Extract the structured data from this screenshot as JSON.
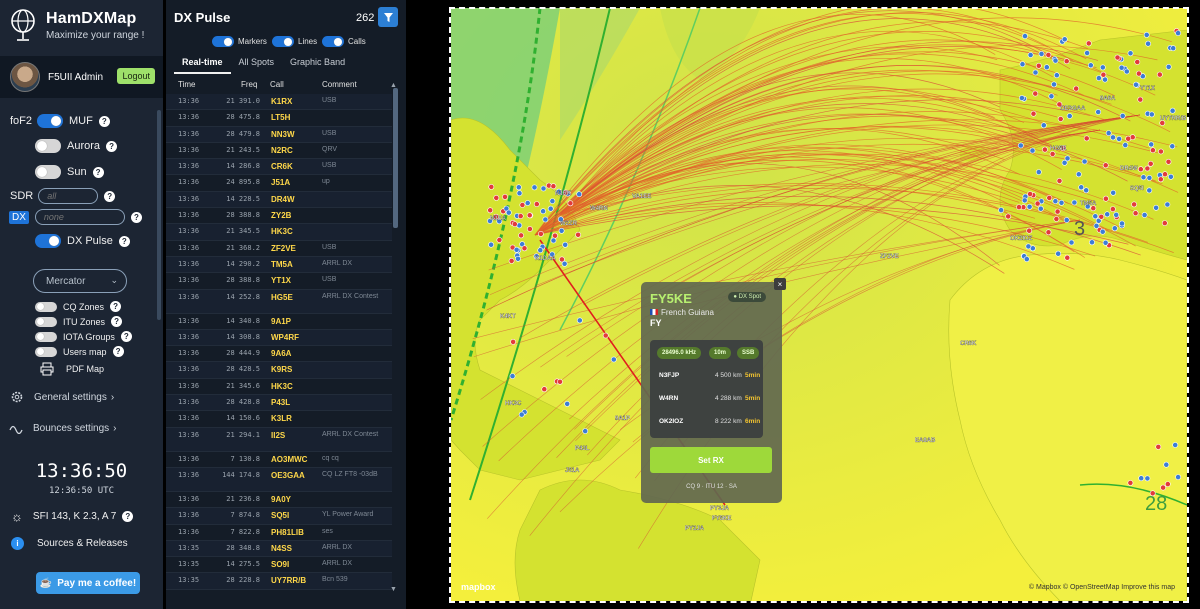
{
  "brand": {
    "title": "HamDXMap",
    "subtitle": "Maximize your range !"
  },
  "user": {
    "name": "F5UII Admin",
    "logout": "Logout"
  },
  "layers": {
    "fof2": "foF2",
    "muf": "MUF",
    "aurora": "Aurora",
    "sun": "Sun",
    "sdr_label": "SDR",
    "sdr_placeholder": "all",
    "dx_label": "DX",
    "dx_placeholder": "none",
    "dx_pulse": "DX Pulse",
    "projection": "Mercator",
    "cq_zones": "CQ Zones",
    "itu_zones": "ITU Zones",
    "iota": "IOTA Groups",
    "users_map": "Users map",
    "pdf_map": "PDF Map",
    "general_settings": "General settings",
    "bounces_settings": "Bounces settings"
  },
  "clock": {
    "local": "13:36:50",
    "utc": "12:36:50 UTC"
  },
  "solar": "SFI 143, K 2.3, A 7",
  "sources": "Sources & Releases",
  "coffee": "Pay me a coffee!",
  "pulse": {
    "title": "DX Pulse",
    "count": "262",
    "toggles": {
      "markers": "Markers",
      "lines": "Lines",
      "calls": "Calls"
    },
    "tabs": [
      "Real-time",
      "All Spots",
      "Graphic Band"
    ],
    "columns": {
      "time": "Time",
      "freq": "Freq",
      "call": "Call",
      "comment": "Comment"
    },
    "rows": [
      {
        "time": "13:36",
        "freq": "21 391.0",
        "call": "K1RX",
        "comment": "USB"
      },
      {
        "time": "13:36",
        "freq": "28 475.8",
        "call": "LT5H",
        "comment": ""
      },
      {
        "time": "13:36",
        "freq": "28 479.8",
        "call": "NN3W",
        "comment": "USB"
      },
      {
        "time": "13:36",
        "freq": "21 243.5",
        "call": "N2RC",
        "comment": "QRV"
      },
      {
        "time": "13:36",
        "freq": "14 286.8",
        "call": "CR6K",
        "comment": "USB"
      },
      {
        "time": "13:36",
        "freq": "24 895.8",
        "call": "J51A",
        "comment": "up"
      },
      {
        "time": "13:36",
        "freq": "14 228.5",
        "call": "DR4W",
        "comment": ""
      },
      {
        "time": "13:36",
        "freq": "28 388.8",
        "call": "ZY2B",
        "comment": ""
      },
      {
        "time": "13:36",
        "freq": "21 345.5",
        "call": "HK3C",
        "comment": ""
      },
      {
        "time": "13:36",
        "freq": "21 368.2",
        "call": "ZF2VE",
        "comment": "USB"
      },
      {
        "time": "13:36",
        "freq": "14 290.2",
        "call": "TM5A",
        "comment": "ARRL DX"
      },
      {
        "time": "13:36",
        "freq": "28 388.8",
        "call": "YT1X",
        "comment": "USB"
      },
      {
        "time": "13:36",
        "freq": "14 252.8",
        "call": "HG5E",
        "comment": "ARRL DX Contest"
      },
      {
        "time": "13:36",
        "freq": "14 340.8",
        "call": "9A1P",
        "comment": ""
      },
      {
        "time": "13:36",
        "freq": "14 308.8",
        "call": "WP4RF",
        "comment": ""
      },
      {
        "time": "13:36",
        "freq": "28 444.9",
        "call": "9A6A",
        "comment": ""
      },
      {
        "time": "13:36",
        "freq": "28 428.5",
        "call": "K9RS",
        "comment": ""
      },
      {
        "time": "13:36",
        "freq": "21 345.6",
        "call": "HK3C",
        "comment": ""
      },
      {
        "time": "13:36",
        "freq": "28 428.8",
        "call": "P43L",
        "comment": ""
      },
      {
        "time": "13:36",
        "freq": "14 150.6",
        "call": "K3LR",
        "comment": ""
      },
      {
        "time": "13:36",
        "freq": "21 294.1",
        "call": "II2S",
        "comment": "ARRL DX Contest"
      },
      {
        "time": "13:36",
        "freq": "7 130.8",
        "call": "AO3MWC",
        "comment": "cq cq"
      },
      {
        "time": "13:36",
        "freq": "144 174.8",
        "call": "OE3GAA",
        "comment": "CQ LZ FT8 -03dB"
      },
      {
        "time": "13:36",
        "freq": "21 236.8",
        "call": "9A0Y",
        "comment": ""
      },
      {
        "time": "13:36",
        "freq": "7 874.8",
        "call": "SQ5I",
        "comment": "YL Power Award"
      },
      {
        "time": "13:36",
        "freq": "7 822.8",
        "call": "PH81LIB",
        "comment": "ses"
      },
      {
        "time": "13:35",
        "freq": "28 348.8",
        "call": "N4SS",
        "comment": "ARRL DX"
      },
      {
        "time": "13:35",
        "freq": "14 275.5",
        "call": "SO9I",
        "comment": "ARRL DX"
      },
      {
        "time": "13:35",
        "freq": "28 228.8",
        "call": "UY7RR/B",
        "comment": "Bcn 539"
      }
    ]
  },
  "popup": {
    "call": "FY5KE",
    "badge": "DX Spot",
    "country": "French Guiana",
    "prefix": "FY",
    "freq": "28496.0 kHz",
    "band": "10m",
    "mode": "SSB",
    "spotters": [
      {
        "call": "N3FJP",
        "km": "4 500 km",
        "age": "5min"
      },
      {
        "call": "W4RN",
        "km": "4 288 km",
        "age": "5min"
      },
      {
        "call": "OK2IOZ",
        "km": "8 222 km",
        "age": "6min"
      }
    ],
    "set_rx": "Set RX",
    "cq": "CQ 9",
    "itu": "ITU 12",
    "continent": "SA"
  },
  "map": {
    "attribution": "© Mapbox © OpenStreetMap Improve this map",
    "logo": "mapbox",
    "zone_labels": [
      "3",
      "28"
    ],
    "callsigns": [
      "N1RK",
      "W4RN",
      "W2ZR",
      "K1DAA",
      "N1EA",
      "VA1EE",
      "P43L",
      "9A1P",
      "HK3C",
      "ZF2VE",
      "CR6K",
      "EA8AB",
      "FY5KE",
      "PY2JA",
      "PY3JA",
      "J51A",
      "K4KT",
      "OK2IOZ",
      "TM5A",
      "DR4W",
      "HG5E",
      "YT1X",
      "9A6A",
      "UY7RR/B",
      "SQ5I",
      "OE3GAA"
    ],
    "colors": {
      "ocean": "#f2ee40",
      "land": "#d6e236",
      "lines": "#e2662a",
      "muf": "#33b233",
      "spot": "#e23b3b",
      "spotter": "#3c7dd6"
    }
  }
}
